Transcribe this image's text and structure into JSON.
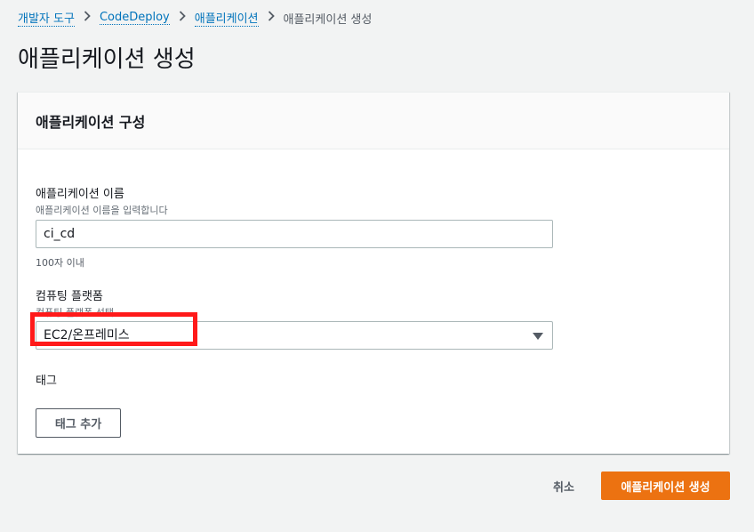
{
  "breadcrumb": {
    "items": [
      {
        "label": "개발자 도구"
      },
      {
        "label": "CodeDeploy"
      },
      {
        "label": "애플리케이션"
      }
    ],
    "current": "애플리케이션 생성"
  },
  "page": {
    "title": "애플리케이션 생성"
  },
  "panel": {
    "title": "애플리케이션 구성",
    "app_name": {
      "label": "애플리케이션 이름",
      "description": "애플리케이션 이름을 입력합니다",
      "value": "ci_cd",
      "constraint": "100자 이내"
    },
    "compute_platform": {
      "label": "컴퓨팅 플랫폼",
      "description": "컴퓨팅 플랫폼 선택",
      "selected": "EC2/온프레미스"
    },
    "tags": {
      "label": "태그",
      "add_button": "태그 추가"
    }
  },
  "actions": {
    "cancel": "취소",
    "create": "애플리케이션 생성"
  },
  "colors": {
    "accent": "#ec7211",
    "link": "#0073bb",
    "highlight": "#ff1a1a"
  },
  "icons": {
    "breadcrumb_separator": "chevron-right-icon",
    "select_arrow": "caret-down-icon"
  }
}
